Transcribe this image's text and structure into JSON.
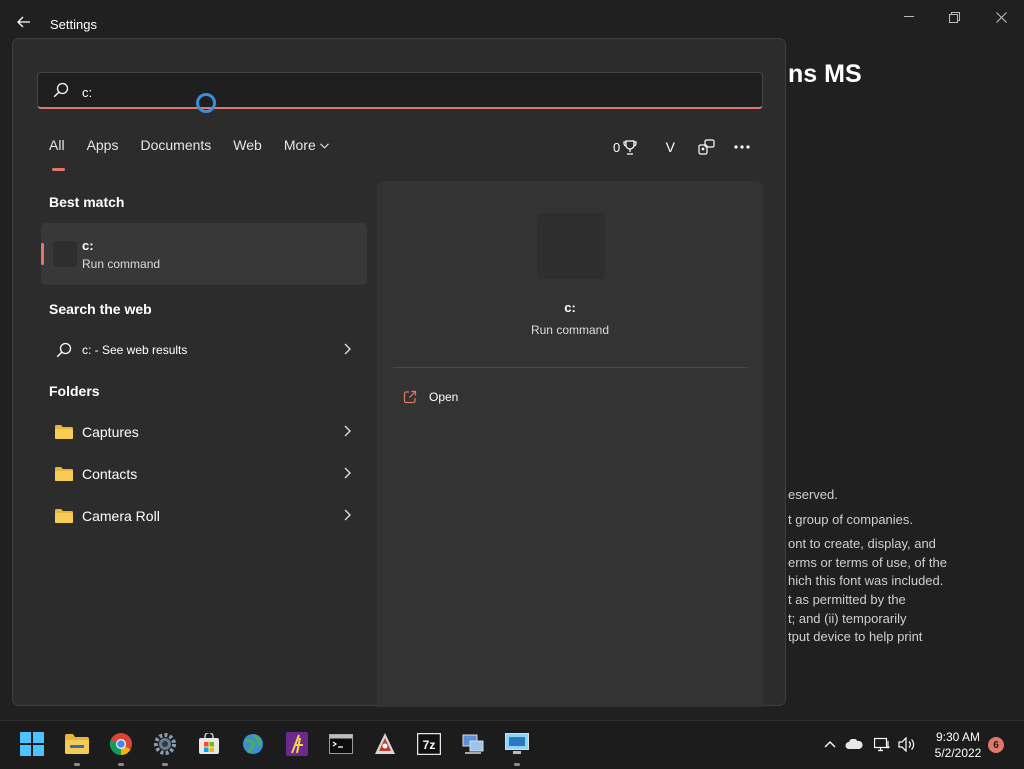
{
  "settings_window": {
    "title": "Settings",
    "heading_fragment": "ns MS",
    "body_lines": [
      "eserved.",
      "t group of companies.",
      "ont to create, display, and",
      "erms or terms of use, of the",
      "hich this font was included.",
      "t as permitted by the",
      "t; and (ii) temporarily",
      "tput device to help print"
    ]
  },
  "search": {
    "query": "c:"
  },
  "filter_tabs": [
    {
      "label": "All",
      "active": true
    },
    {
      "label": "Apps",
      "active": false
    },
    {
      "label": "Documents",
      "active": false
    },
    {
      "label": "Web",
      "active": false
    },
    {
      "label": "More",
      "active": false
    }
  ],
  "rewards_points": "0",
  "account_initial": "V",
  "best_match": {
    "heading": "Best match",
    "name": "c:",
    "type": "Run command"
  },
  "web_section": {
    "heading": "Search the web",
    "result_label": "c: - See web results"
  },
  "folders_section": {
    "heading": "Folders",
    "items": [
      {
        "label": "Captures"
      },
      {
        "label": "Contacts"
      },
      {
        "label": "Camera Roll"
      }
    ]
  },
  "detail_pane": {
    "title": "c:",
    "subtitle": "Run command",
    "actions": [
      {
        "label": "Open"
      }
    ]
  },
  "taskbar": {
    "apps": [
      "start-icon",
      "file-explorer-icon",
      "chrome-icon",
      "settings-icon",
      "store-icon",
      "browser-globe-icon",
      "app-icon",
      "terminal-icon",
      "app-icon",
      "7zip-icon",
      "network-icon",
      "remote-desktop-icon"
    ],
    "clock_time": "9:30 AM",
    "clock_date": "5/2/2022",
    "notification_count": "6"
  },
  "colors": {
    "accent": "#e0786a",
    "flyout_bg": "#2c2c2c",
    "window_bg": "#202020",
    "busy_ring": "#3b8fd8"
  }
}
